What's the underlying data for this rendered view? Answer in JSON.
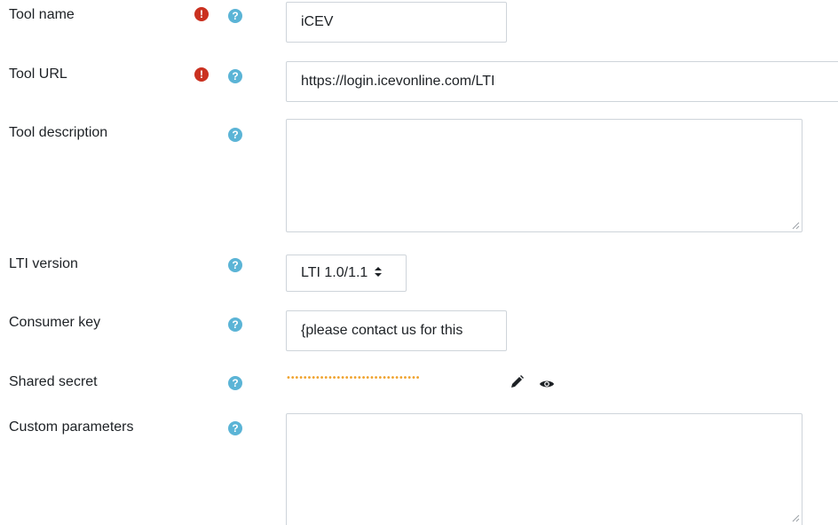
{
  "form": {
    "tool_name": {
      "label": "Tool name",
      "value": "iCEV",
      "required": true
    },
    "tool_url": {
      "label": "Tool URL",
      "value": "https://login.icevonline.com/LTI",
      "required": true
    },
    "tool_description": {
      "label": "Tool description",
      "value": ""
    },
    "lti_version": {
      "label": "LTI version",
      "selected": "LTI 1.0/1.1"
    },
    "consumer_key": {
      "label": "Consumer key",
      "value": "{please contact us for this"
    },
    "shared_secret": {
      "label": "Shared secret",
      "masked_value": "••••••••••••••••••••••••••••••••"
    },
    "custom_parameters": {
      "label": "Custom parameters",
      "value": ""
    }
  },
  "icons": {
    "required": "exclamation-circle-icon",
    "help": "question-circle-icon",
    "edit": "pencil-icon",
    "reveal": "eye-icon"
  },
  "colors": {
    "required_icon": "#ca3120",
    "help_icon": "#5bb4d6",
    "secret_dots": "#f0a32e",
    "input_border": "#ced4da"
  }
}
